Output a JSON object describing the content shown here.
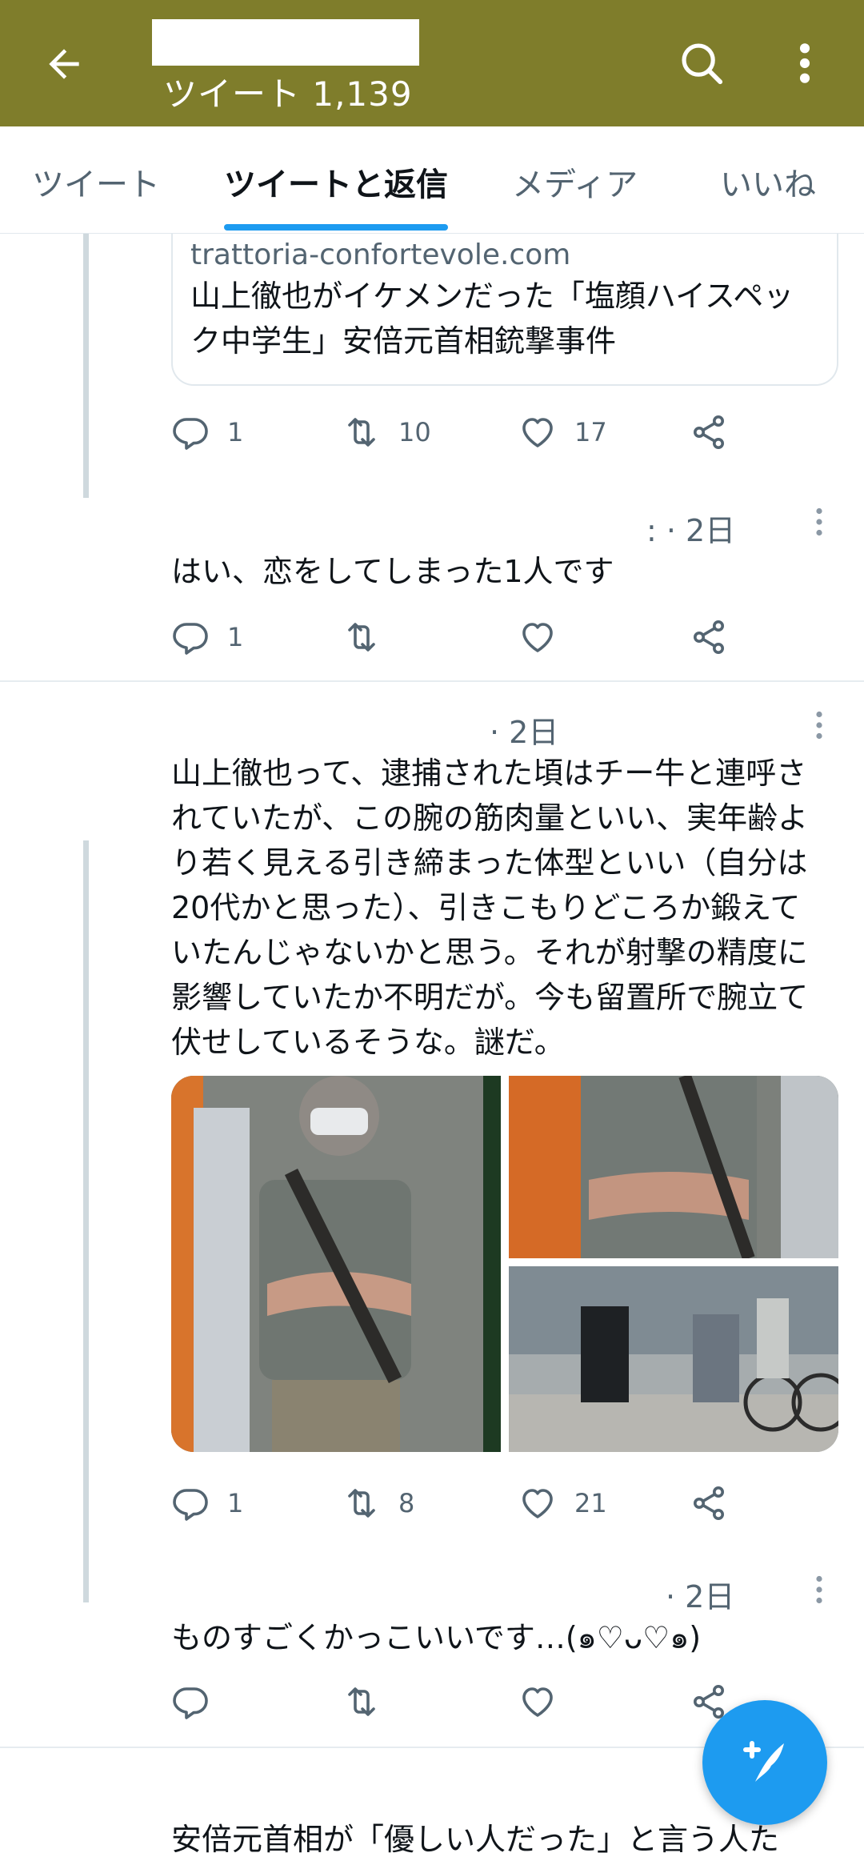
{
  "header": {
    "tweet_count": "ツイート 1,139"
  },
  "tabs": [
    {
      "label": "ツイート"
    },
    {
      "label": "ツイートと返信"
    },
    {
      "label": "メディア"
    },
    {
      "label": "いいね"
    }
  ],
  "tweets": [
    {
      "link_card": {
        "domain": "trattoria-confortevole.com",
        "title": "山上徹也がイケメンだった「塩顔ハイスペック中学生」安倍元首相銃撃事件"
      },
      "replies": "1",
      "retweets": "10",
      "likes": "17"
    },
    {
      "meta": ": · 2日",
      "text": "はい、恋をしてしまった1人です",
      "replies": "1",
      "retweets": "",
      "likes": ""
    },
    {
      "meta": "· 2日",
      "text": "山上徹也って、逮捕された頃はチー牛と連呼されていたが、この腕の筋肉量といい、実年齢より若く見える引き締まった体型といい（自分は20代かと思った）、引きこもりどころか鍛えていたんじゃないかと思う。それが射撃の精度に影響していたか不明だが。今も留置所で腕立て伏せしているそうな。謎だ。",
      "replies": "1",
      "retweets": "8",
      "likes": "21"
    },
    {
      "meta": "· 2日",
      "text": "ものすごくかっこいいです…(๑♡ᴗ♡๑)",
      "replies": "",
      "retweets": "",
      "likes": ""
    },
    {
      "text": "安倍元首相が「優しい人だった」と言う人た"
    }
  ],
  "colors": {
    "header_bg": "#7f7d2b",
    "accent": "#1d9bf0",
    "thread_line": "#cfd9de"
  },
  "icons": [
    "back-arrow-icon",
    "search-icon",
    "more-vertical-icon",
    "reply-icon",
    "retweet-icon",
    "like-icon",
    "share-icon",
    "compose-tweet-icon"
  ]
}
